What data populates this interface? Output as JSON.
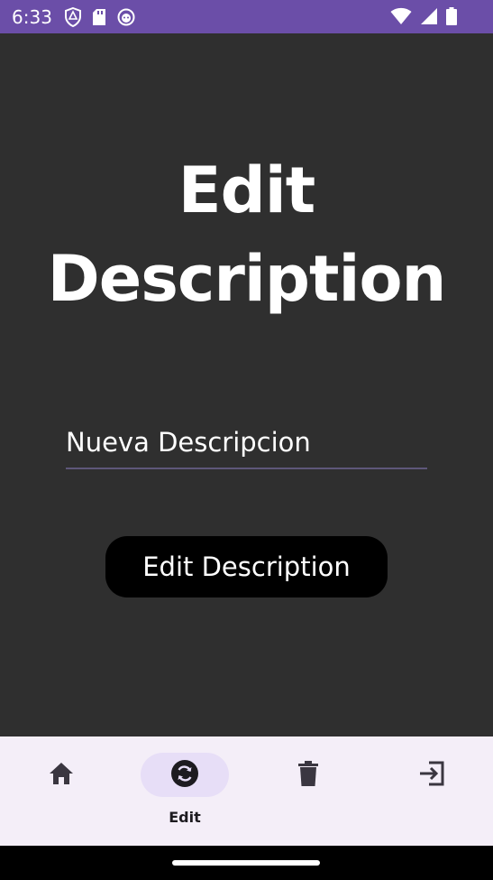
{
  "status_bar": {
    "time": "6:33",
    "left_icons": [
      "shield-icon",
      "sd-card-icon",
      "app-notification-icon"
    ],
    "right_icons": [
      "wifi-icon",
      "cell-signal-icon",
      "battery-icon"
    ]
  },
  "page": {
    "title": "Edit Description"
  },
  "form": {
    "description_value": "Nueva Descripcion",
    "submit_label": "Edit Description"
  },
  "bottom_nav": {
    "items": [
      {
        "icon": "home-icon",
        "label": "",
        "active": false
      },
      {
        "icon": "sync-icon",
        "label": "Edit",
        "active": true
      },
      {
        "icon": "trash-icon",
        "label": "",
        "active": false
      },
      {
        "icon": "logout-icon",
        "label": "",
        "active": false
      }
    ]
  },
  "colors": {
    "status_bar": "#6b4ea8",
    "background": "#2f2f2f",
    "nav_background": "#f4eef8",
    "nav_active_pill": "#e7def7",
    "input_underline": "#5e5779",
    "button": "#000000"
  }
}
